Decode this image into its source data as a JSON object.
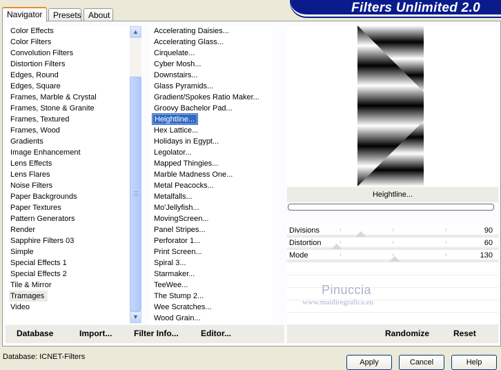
{
  "tabs": [
    "Navigator",
    "Presets",
    "About"
  ],
  "banner_title": "Filters Unlimited 2.0",
  "categories": [
    "Color Effects",
    "Color Filters",
    "Convolution Filters",
    "Distortion Filters",
    "Edges, Round",
    "Edges, Square",
    "Frames, Marble & Crystal",
    "Frames, Stone & Granite",
    "Frames, Textured",
    "Frames, Wood",
    "Gradients",
    "Image Enhancement",
    "Lens Effects",
    "Lens Flares",
    "Noise Filters",
    "Paper Backgrounds",
    "Paper Textures",
    "Pattern Generators",
    "Render",
    "Sapphire Filters 03",
    "Simple",
    "Special Effects 1",
    "Special Effects 2",
    "Tile & Mirror",
    "Tramages",
    "Video"
  ],
  "selected_category": "Tramages",
  "filters": [
    "Accelerating Daisies...",
    "Accelerating Glass...",
    "Cirquelate...",
    "Cyber Mosh...",
    "Downstairs...",
    "Glass Pyramids...",
    "Gradient/Spokes Ratio Maker...",
    "Groovy Bachelor Pad...",
    "Heightline...",
    "Hex Lattice...",
    "Holidays in Egypt...",
    "Legolator...",
    "Mapped Thingies...",
    "Marble Madness One...",
    "Metal Peacocks...",
    "Metalfalls...",
    "Mo'Jellyfish...",
    "MovingScreen...",
    "Panel Stripes...",
    "Perforator 1...",
    "Print Screen...",
    "Spiral 3...",
    "Starmaker...",
    "TeeWee...",
    "The Stump 2...",
    "Wee Scratches...",
    "Wood Grain..."
  ],
  "selected_filter": "Heightline...",
  "preview_filter_name": "Heightline...",
  "progress_fraction": 0,
  "params": [
    {
      "name": "Divisions",
      "value": "90",
      "fraction": 0.35
    },
    {
      "name": "Distortion",
      "value": "60",
      "fraction": 0.235
    },
    {
      "name": "Mode",
      "value": "130",
      "fraction": 0.51
    }
  ],
  "watermark": {
    "line1": "Pinuccia",
    "line2": "www.maidiregrafica.eu"
  },
  "toolbar_left": {
    "database": "Database",
    "import": "Import...",
    "filter_info": "Filter Info...",
    "editor": "Editor..."
  },
  "toolbar_right": {
    "randomize": "Randomize",
    "reset": "Reset"
  },
  "status": "Database:  ICNET-Filters",
  "dialog_buttons": [
    "Apply",
    "Cancel",
    "Help"
  ],
  "colors": {
    "banner": "#0a1c8c",
    "selection": "#316ac5",
    "tab_highlight": "#e68b2c",
    "panel_bg": "#ecebe5"
  }
}
